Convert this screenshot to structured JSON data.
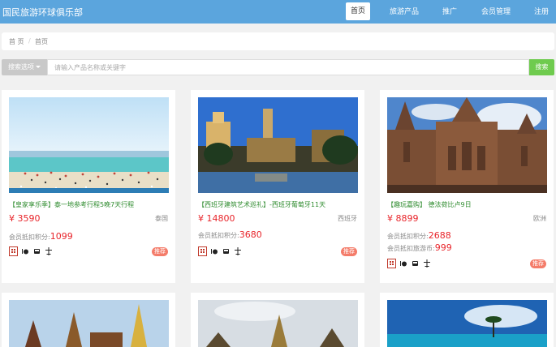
{
  "nav": {
    "brand": "国民旅游环球俱乐部",
    "items": [
      "首页",
      "旅游产品",
      "推广",
      "会员管理",
      "注册"
    ]
  },
  "breadcrumb": [
    "首 页",
    "首页"
  ],
  "search": {
    "option_label": "搜索选项",
    "placeholder": "请输入产品名称或关键字",
    "button": "搜索"
  },
  "icons": [
    "hotel-icon",
    "dining-icon",
    "bus-icon",
    "flight-icon"
  ],
  "cards": [
    {
      "title": "【皇家享乐季】泰一地参考行程5晚7天行程",
      "price": "¥ 3590",
      "region": "泰国",
      "points_label": "会员抵扣积分:",
      "points": "1099",
      "badge": "推荐"
    },
    {
      "title": "【西班牙建筑艺术巡礼】-西班牙葡萄牙11天",
      "price": "¥ 14800",
      "region": "西班牙",
      "points_label": "会员抵扣积分:",
      "points": "3680",
      "badge": "推荐"
    },
    {
      "title": "【趣玩嘉购】 德法荷比卢9日",
      "price": "¥ 8899",
      "region": "欧洲",
      "points_label": "会员抵扣积分:",
      "points": "2688",
      "coins_label": "会员抵扣旅游币:",
      "coins": "999",
      "badge": "推荐"
    }
  ],
  "colors": {
    "nav_bg": "#5ba5dd",
    "search_button": "#6fcb4e",
    "price": "#e8242a",
    "title_green": "#2e8b2e",
    "badge": "#f47c6a"
  }
}
